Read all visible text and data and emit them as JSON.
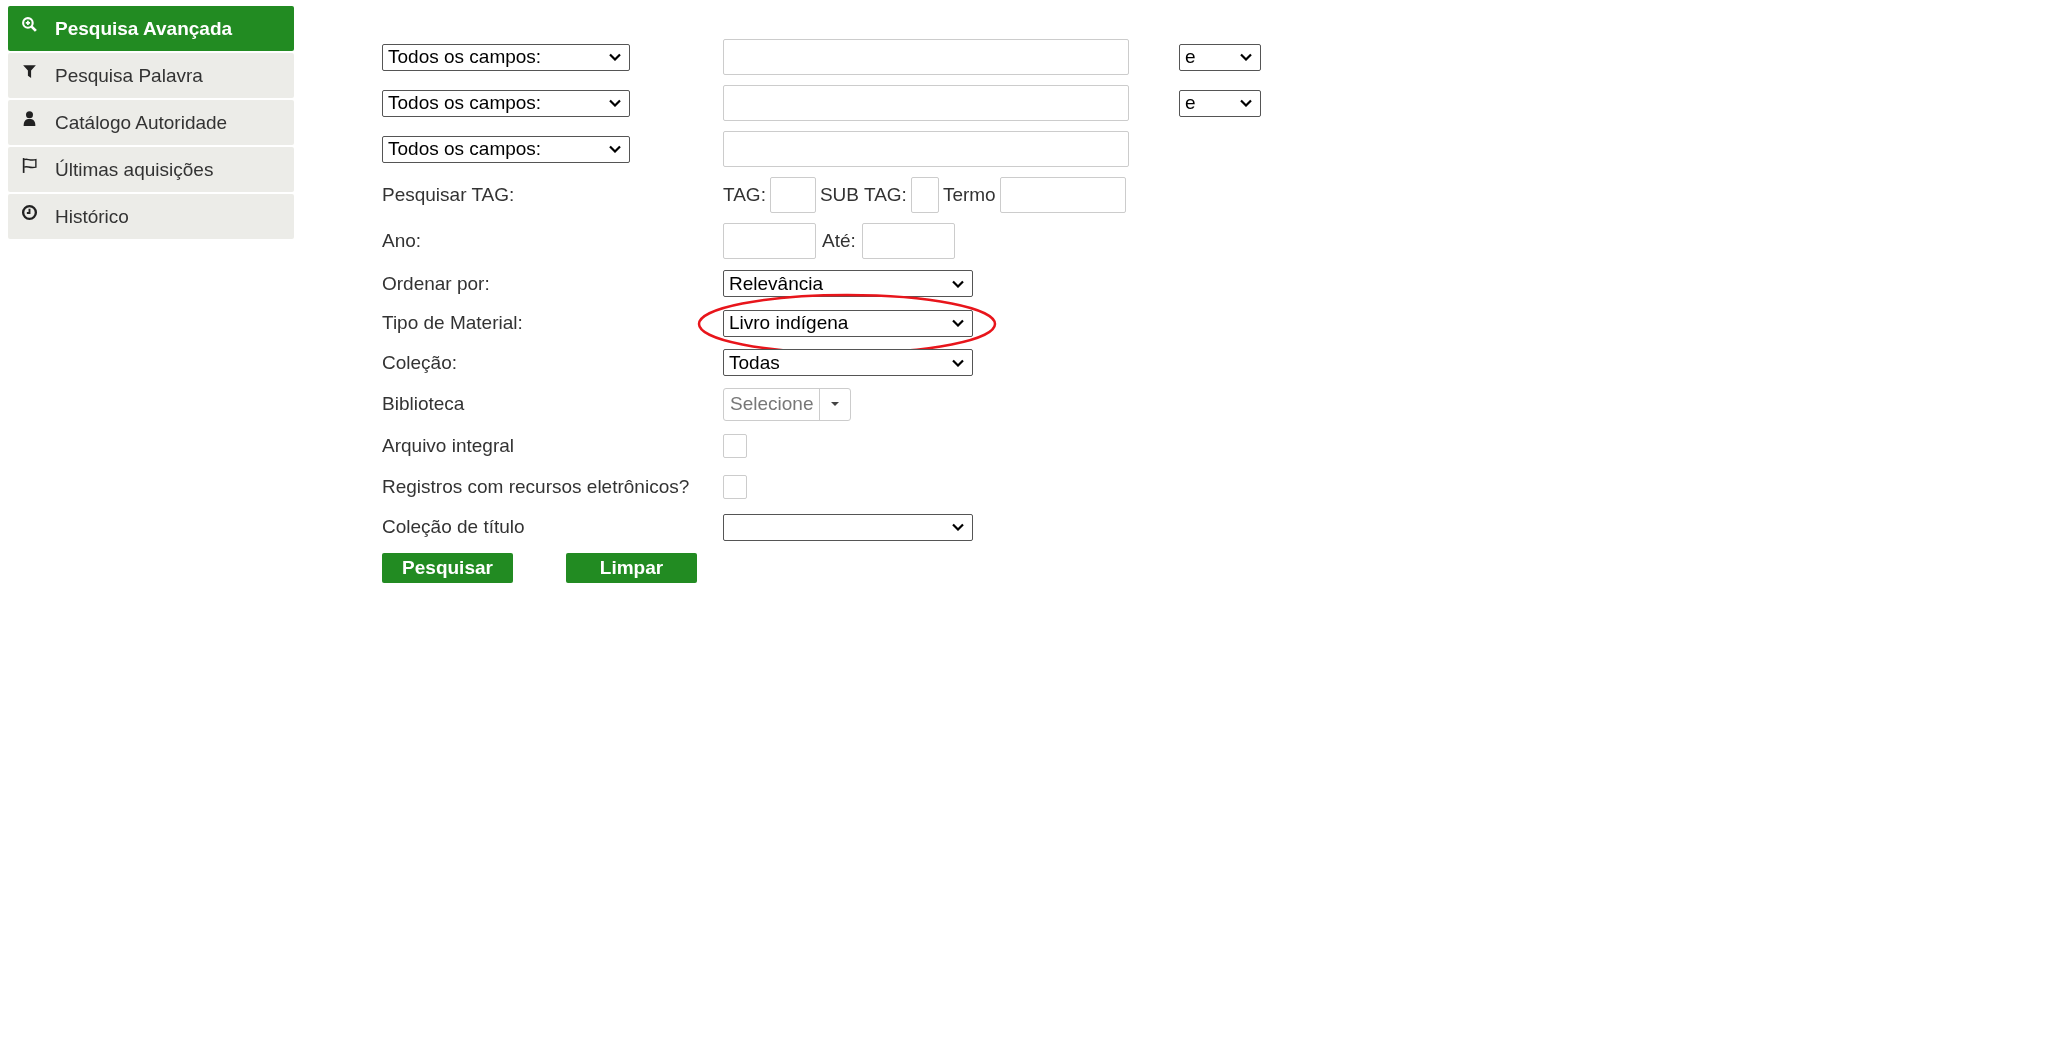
{
  "sidebar": {
    "items": [
      {
        "label": "Pesquisa Avançada",
        "kind": "search",
        "selected": true
      },
      {
        "label": "Pesquisa Palavra",
        "kind": "filter",
        "selected": false
      },
      {
        "label": "Catálogo Autoridade",
        "kind": "person",
        "selected": false
      },
      {
        "label": "Últimas aquisições",
        "kind": "flag",
        "selected": false
      },
      {
        "label": "Histórico",
        "kind": "clock",
        "selected": false
      }
    ]
  },
  "form": {
    "rows": [
      {
        "kind": "query",
        "field": "Todos os campos:",
        "conjunction": "e"
      },
      {
        "kind": "query",
        "field": "Todos os campos:",
        "conjunction": "e"
      },
      {
        "kind": "query",
        "field": "Todos os campos:"
      },
      {
        "kind": "tag",
        "label": "Pesquisar TAG:",
        "tag_label": "TAG:",
        "subtag_label": "SUB TAG:",
        "term_label": "Termo"
      },
      {
        "kind": "range",
        "label": "Ano:",
        "to_label": "Até:"
      },
      {
        "kind": "select",
        "label": "Ordenar por:",
        "value": "Relevância",
        "circled": false
      },
      {
        "kind": "select",
        "label": "Tipo de Material:",
        "value": "Livro indígena",
        "circled": true
      },
      {
        "kind": "select",
        "label": "Coleção:",
        "value": "Todas",
        "circled": false
      },
      {
        "kind": "combo",
        "label": "Biblioteca",
        "placeholder": "Selecione"
      },
      {
        "kind": "checkbox",
        "label": "Arquivo integral",
        "checked": false
      },
      {
        "kind": "checkbox",
        "label": "Registros com recursos eletrônicos?",
        "checked": false
      },
      {
        "kind": "select",
        "label": "Coleção de título",
        "value": "",
        "circled": false
      }
    ],
    "buttons": [
      "Pesquisar",
      "Limpar"
    ]
  }
}
